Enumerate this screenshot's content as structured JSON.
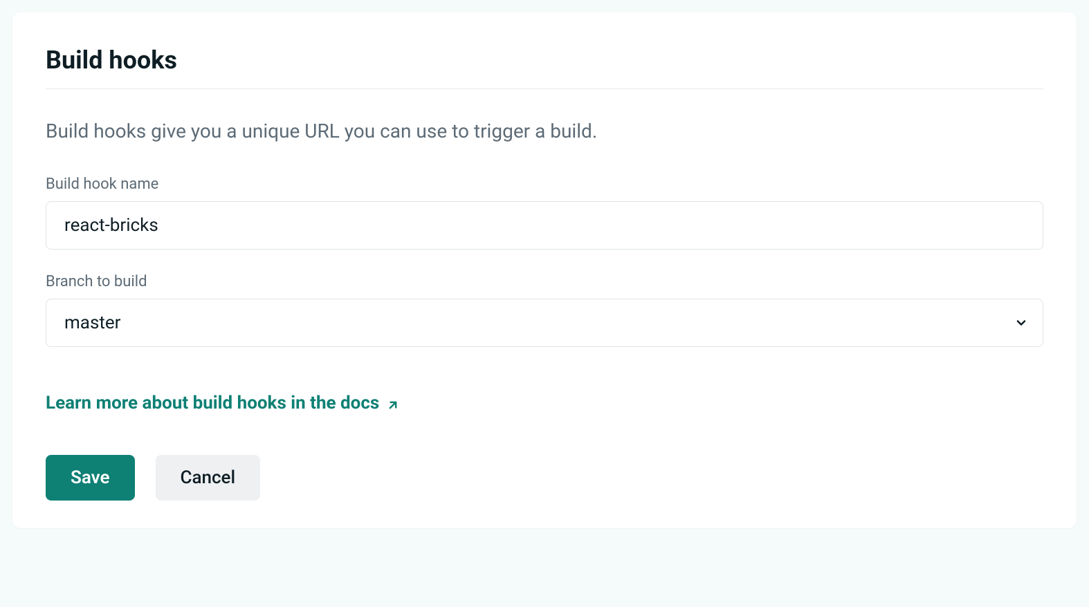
{
  "section": {
    "title": "Build hooks",
    "description": "Build hooks give you a unique URL you can use to trigger a build."
  },
  "form": {
    "hook_name": {
      "label": "Build hook name",
      "value": "react-bricks"
    },
    "branch": {
      "label": "Branch to build",
      "value": "master"
    }
  },
  "docs_link": {
    "label": "Learn more about build hooks in the docs"
  },
  "actions": {
    "save_label": "Save",
    "cancel_label": "Cancel"
  },
  "colors": {
    "accent": "#0e8074",
    "text_primary": "#0f1e25",
    "text_muted": "#5d6b76",
    "border": "#dfe3e6"
  }
}
